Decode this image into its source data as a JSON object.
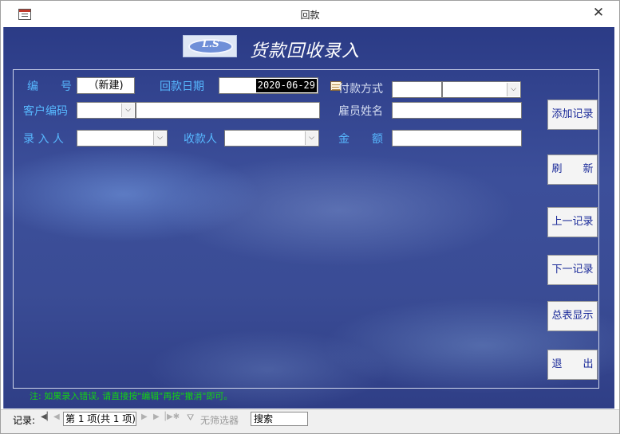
{
  "window": {
    "title": "回款",
    "close_glyph": "✕"
  },
  "heading": {
    "logo_text": "L.S",
    "title": "货款回收录入"
  },
  "fields": {
    "number": {
      "label": "编　　号",
      "value": "（新建)"
    },
    "return_date": {
      "label": "回款日期",
      "value": "2020-06-29"
    },
    "payment_method": {
      "label": "付款方式",
      "value": ""
    },
    "customer_code": {
      "label": "客户编码",
      "value": "",
      "name_value": ""
    },
    "employee_name": {
      "label": "雇员姓名",
      "value": ""
    },
    "entered_by": {
      "label": "录 入 人",
      "value": ""
    },
    "payee": {
      "label": "收款人",
      "value": ""
    },
    "amount": {
      "label": "金　　额",
      "value": ""
    }
  },
  "buttons": {
    "add_record": "添加记录",
    "refresh": "刷　　新",
    "previous": "上一记录",
    "next": "下一记录",
    "summary": "总表显示",
    "exit": "退　　出"
  },
  "note": "注: 如果录入错误, 请直接按\"编辑\"再按\"撤消\"即可。",
  "navigation": {
    "record_label": "记录:",
    "record_position": "第 1 项(共 1 项)",
    "filter_label": "无筛选器",
    "search_text": "搜索"
  },
  "icons": {
    "form_icon": "form-icon",
    "calendar_icon": "calendar-icon",
    "dropdown": "chevron-down-icon",
    "filter": "filter-icon"
  },
  "colors": {
    "background_dark": "#2b3b86",
    "label_blue": "#57b8ff",
    "button_text": "#1a2a99",
    "note_green": "#13d313"
  }
}
